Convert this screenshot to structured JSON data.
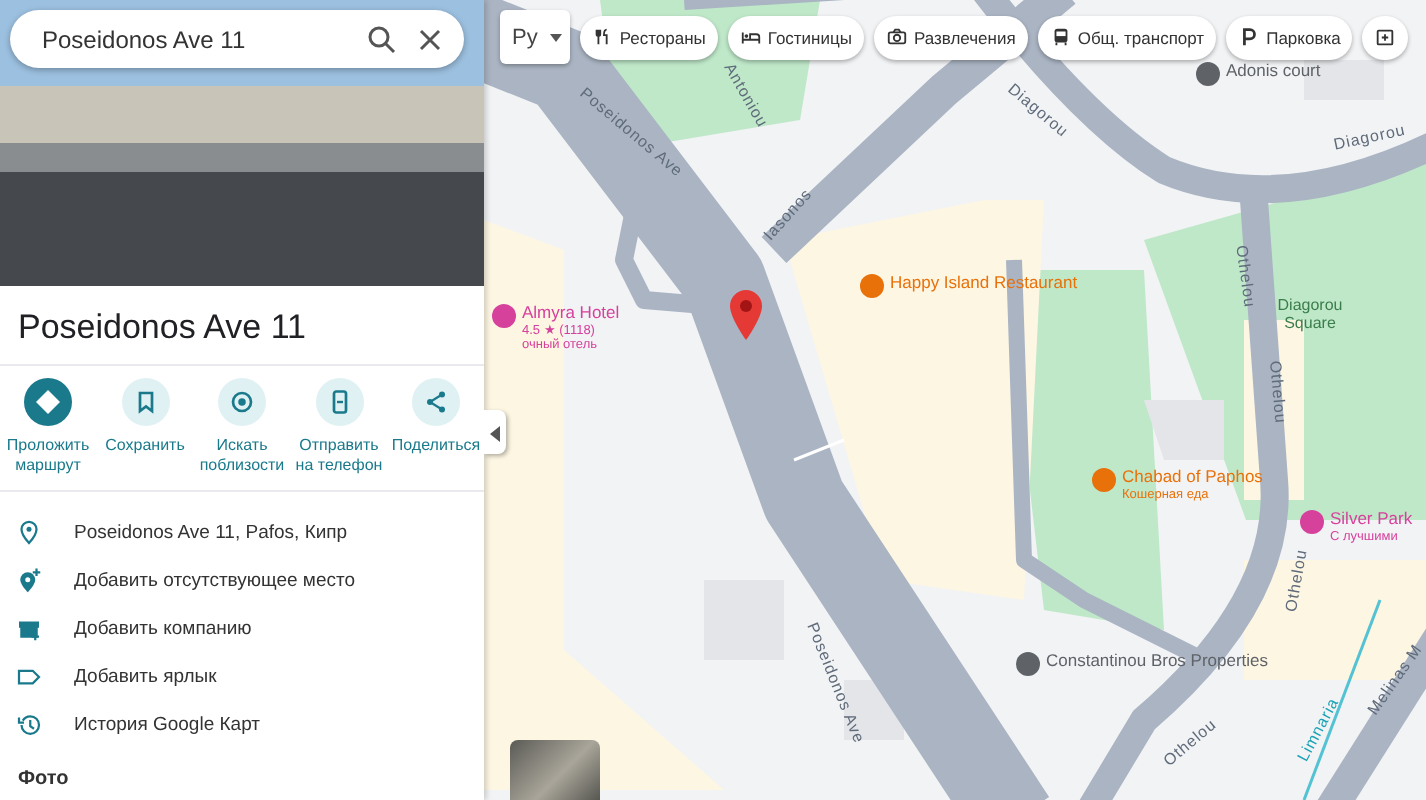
{
  "search": {
    "value": "Poseidonos Ave 11"
  },
  "place": {
    "title": "Poseidonos Ave 11"
  },
  "actions": [
    {
      "label": "Проложить маршрут",
      "primary": true
    },
    {
      "label": "Сохранить",
      "primary": false
    },
    {
      "label": "Искать поблизости",
      "primary": false
    },
    {
      "label": "Отправить на телефон",
      "primary": false
    },
    {
      "label": "Поделиться",
      "primary": false
    }
  ],
  "info_rows": [
    {
      "text": "Poseidonos Ave 11, Pafos, Кипр"
    },
    {
      "text": "Добавить отсутствующее место"
    },
    {
      "text": "Добавить компанию"
    },
    {
      "text": "Добавить ярлык"
    },
    {
      "text": "История Google Карт"
    }
  ],
  "photos_heading": "Фото",
  "map_type": {
    "label": "Ру"
  },
  "chips": [
    {
      "label": "Рестораны"
    },
    {
      "label": "Гостиницы"
    },
    {
      "label": "Развлечения"
    },
    {
      "label": "Общ. транспорт"
    },
    {
      "label": "Парковка"
    }
  ],
  "map_labels": [
    {
      "text": "Antoniou",
      "kind": "street"
    },
    {
      "text": "Diagorou",
      "kind": "street"
    },
    {
      "text": "Diagorou",
      "kind": "street"
    },
    {
      "text": "Poseidonos Ave",
      "kind": "street"
    },
    {
      "text": "Iasonos",
      "kind": "street"
    },
    {
      "text": "Othelou",
      "kind": "street"
    },
    {
      "text": "Othelou",
      "kind": "street"
    },
    {
      "text": "Othelou",
      "kind": "street"
    },
    {
      "text": "Othelou",
      "kind": "street"
    },
    {
      "text": "Poseidonos Ave",
      "kind": "street"
    },
    {
      "text": "Limnaria",
      "kind": "trail"
    },
    {
      "text": "Melinas M",
      "kind": "street"
    },
    {
      "text": "Diagorou Square",
      "kind": "park"
    }
  ],
  "pois": [
    {
      "name": "Adonis court",
      "kind": "place"
    },
    {
      "name": "Almyra Hotel",
      "kind": "hotel",
      "rating": "4.5 ★ (1118)",
      "subtitle": "очный отель"
    },
    {
      "name": "Happy Island Restaurant",
      "kind": "restaurant"
    },
    {
      "name": "Chabad of Paphos",
      "kind": "restaurant",
      "subtitle": "Кошерная еда"
    },
    {
      "name": "Silver Park",
      "kind": "hotel",
      "subtitle": "С лучшими"
    },
    {
      "name": "Constantinou Bros Properties",
      "kind": "place"
    }
  ]
}
